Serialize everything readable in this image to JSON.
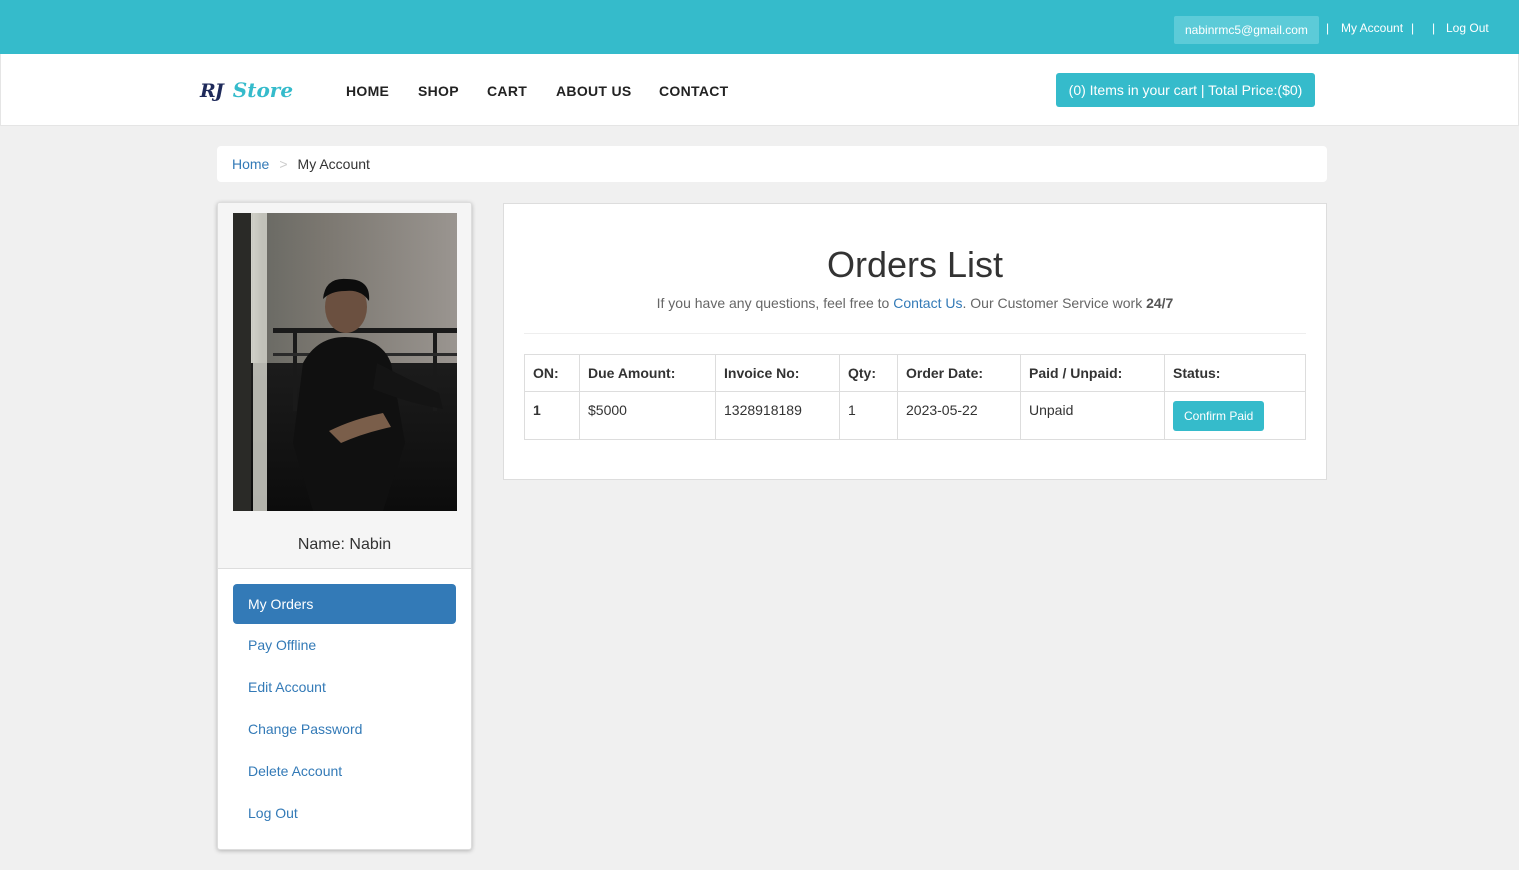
{
  "topbar": {
    "email": "nabinrmc5@gmail.com",
    "separator": "|",
    "my_account": "My Account",
    "log_out": "Log Out"
  },
  "brand": {
    "part1": "RJ",
    "part2": "Store"
  },
  "nav": {
    "items": [
      "HOME",
      "SHOP",
      "CART",
      "ABOUT US",
      "CONTACT"
    ],
    "cart_summary": "(0) Items in your cart | Total Price:($0)"
  },
  "breadcrumb": {
    "home": "Home",
    "separator": ">",
    "current": "My Account"
  },
  "sidebar": {
    "name": "Name: Nabin",
    "menu": [
      "My Orders",
      "Pay Offline",
      "Edit Account",
      "Change Password",
      "Delete Account",
      "Log Out"
    ]
  },
  "orders": {
    "title": "Orders List",
    "subtitle_pre": "If you have any questions, feel free to ",
    "subtitle_link": "Contact Us",
    "subtitle_mid": ". Our Customer Service work ",
    "subtitle_bold": "24/7",
    "columns": [
      "ON:",
      "Due Amount:",
      "Invoice No:",
      "Qty:",
      "Order Date:",
      "Paid / Unpaid:",
      "Status:"
    ],
    "rows": [
      {
        "on": "1",
        "due": "$5000",
        "invoice": "1328918189",
        "qty": "1",
        "date": "2023-05-22",
        "paid": "Unpaid",
        "action": "Confirm Paid"
      }
    ]
  },
  "colors": {
    "accent": "#35bbcb",
    "primary": "#337ab7",
    "page_bg": "#f0f0f0"
  }
}
